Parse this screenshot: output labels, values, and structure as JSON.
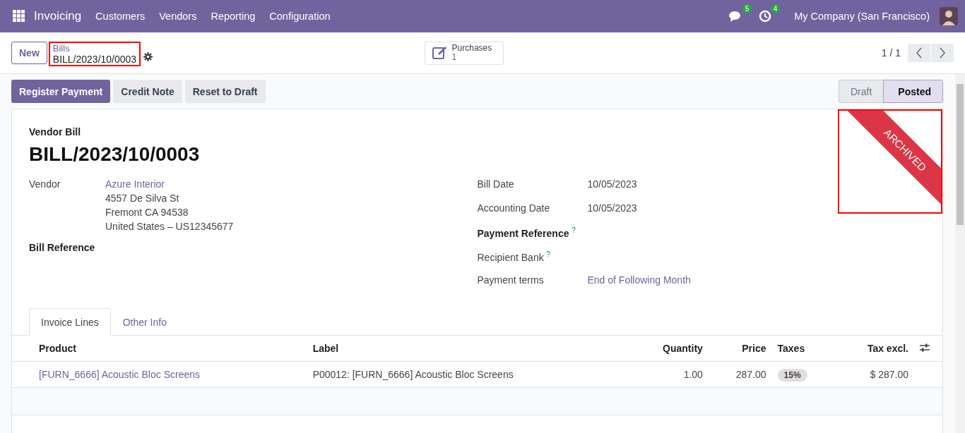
{
  "navbar": {
    "app": "Invoicing",
    "menu": [
      "Customers",
      "Vendors",
      "Reporting",
      "Configuration"
    ],
    "messages_count": "5",
    "activities_count": "4",
    "company": "My Company (San Francisco)"
  },
  "control_panel": {
    "new_button": "New",
    "breadcrumb": {
      "parent": "Bills",
      "current": "BILL/2023/10/0003",
      "highlighted": true
    },
    "smart_button": {
      "label": "Purchases",
      "value": "1"
    },
    "pager": "1 / 1"
  },
  "actions": [
    "Register Payment",
    "Credit Note",
    "Reset to Draft"
  ],
  "stages": [
    {
      "label": "Draft",
      "selected": false
    },
    {
      "label": "Posted",
      "selected": true
    }
  ],
  "ribbon": {
    "text": "ARCHIVED",
    "highlighted": true
  },
  "form": {
    "type_label": "Vendor Bill",
    "name": "BILL/2023/10/0003",
    "left": [
      {
        "label": "Vendor",
        "link": true,
        "lines": [
          "Azure Interior",
          "4557 De Silva St",
          "Fremont CA 94538",
          "United States – US12345677"
        ]
      },
      {
        "label": "Bill Reference",
        "bold": true
      }
    ],
    "right": [
      {
        "label": "Bill Date",
        "value": "10/05/2023"
      },
      {
        "label": "Accounting Date",
        "value": "10/05/2023"
      },
      {
        "label": "Payment Reference",
        "bold": true,
        "help": "?"
      },
      {
        "label": "Recipient Bank",
        "help": "?"
      },
      {
        "label": "Payment terms",
        "value": "End of Following Month",
        "link": true
      }
    ]
  },
  "tabs": [
    {
      "label": "Invoice Lines",
      "selected": true
    },
    {
      "label": "Other Info",
      "selected": false
    }
  ],
  "table": {
    "columns": [
      "Product",
      "Label",
      "Quantity",
      "Price",
      "Taxes",
      "Tax excl."
    ],
    "rows": [
      {
        "product": "[FURN_6666] Acoustic Bloc Screens",
        "label": "P00012: [FURN_6666] Acoustic Bloc Screens",
        "quantity": "1.00",
        "price": "287.00",
        "taxes": "15%",
        "tax_excl": "$ 287.00"
      }
    ]
  }
}
